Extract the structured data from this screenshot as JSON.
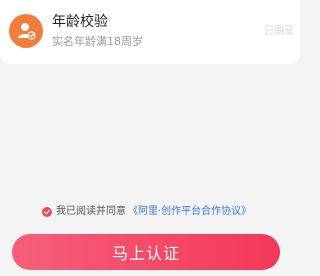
{
  "verification": {
    "title": "年龄校验",
    "subtitle": "实名年龄满18周岁",
    "status": "已满足"
  },
  "agreement": {
    "checked": true,
    "prefix": "我已阅读并同意",
    "link": "《阿里·创作平台合作协议》"
  },
  "action": {
    "button_label": "马上认证"
  },
  "colors": {
    "accent": "#f4385a",
    "avatar": "#f07d3c",
    "link": "#3b79d9"
  }
}
